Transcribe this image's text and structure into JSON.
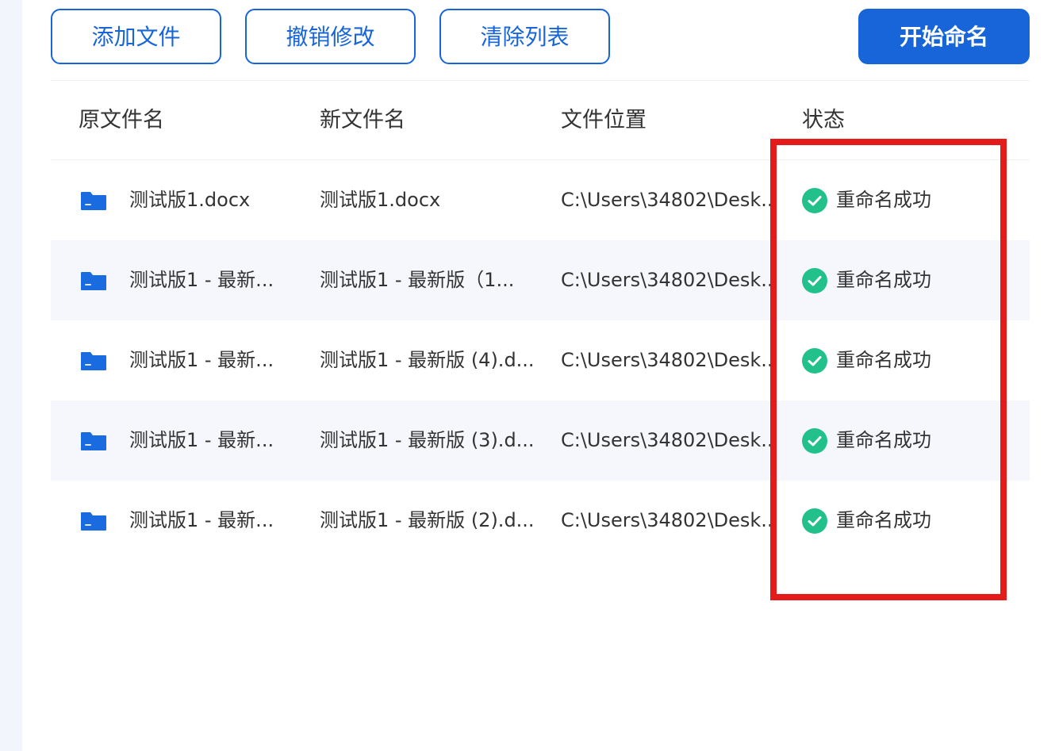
{
  "toolbar": {
    "add_files_label": "添加文件",
    "undo_label": "撤销修改",
    "clear_list_label": "清除列表",
    "start_rename_label": "开始命名"
  },
  "table": {
    "headers": {
      "original_name": "原文件名",
      "new_name": "新文件名",
      "location": "文件位置",
      "status": "状态"
    },
    "rows": [
      {
        "original_name": "测试版1.docx",
        "new_name": "测试版1.docx",
        "location": "C:\\Users\\34802\\Desk...",
        "status": "重命名成功"
      },
      {
        "original_name": "测试版1 - 最新...",
        "new_name": "测试版1 - 最新版（1...",
        "location": "C:\\Users\\34802\\Desk...",
        "status": "重命名成功"
      },
      {
        "original_name": "测试版1 - 最新...",
        "new_name": "测试版1 - 最新版 (4).d...",
        "location": "C:\\Users\\34802\\Desk...",
        "status": "重命名成功"
      },
      {
        "original_name": "测试版1 - 最新...",
        "new_name": "测试版1 - 最新版 (3).d...",
        "location": "C:\\Users\\34802\\Desk...",
        "status": "重命名成功"
      },
      {
        "original_name": "测试版1 - 最新...",
        "new_name": "测试版1 - 最新版 (2).d...",
        "location": "C:\\Users\\34802\\Desk...",
        "status": "重命名成功"
      }
    ]
  },
  "colors": {
    "primary": "#1765d8",
    "success": "#22c08a",
    "highlight": "#e31b1b",
    "row_alt": "#f5f7fc",
    "folder": "#1a6ae0"
  },
  "icons": {
    "file_row": "folder-icon",
    "status_success": "check-circle-icon"
  }
}
